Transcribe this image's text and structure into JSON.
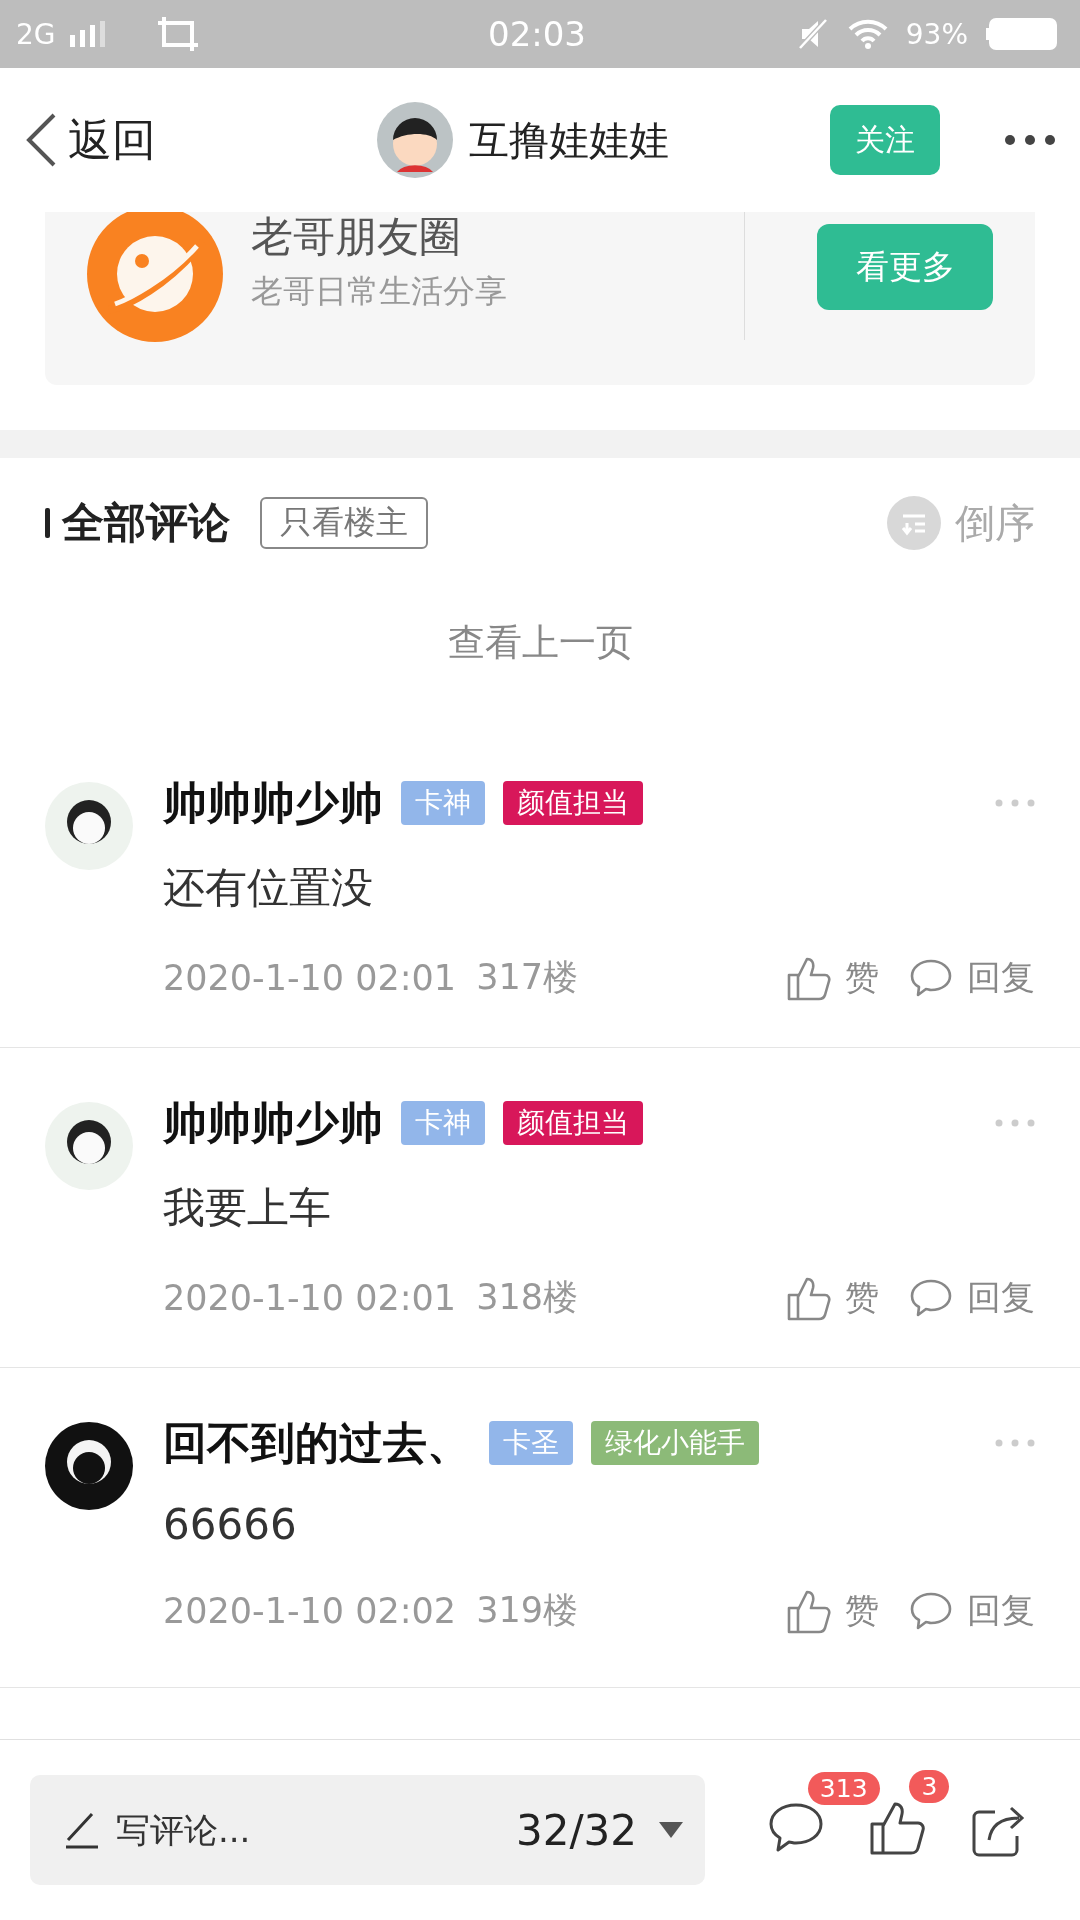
{
  "status_bar": {
    "network": "2G",
    "time": "02:03",
    "battery": "93%"
  },
  "header": {
    "back": "返回",
    "title": "互撸娃娃娃",
    "follow": "关注"
  },
  "group_card": {
    "name": "老哥朋友圈",
    "description": "老哥日常生活分享",
    "button": "看更多"
  },
  "comments_header": {
    "title": "全部评论",
    "filter": "只看楼主",
    "sort": "倒序"
  },
  "previous_page": "查看上一页",
  "comments": [
    {
      "name": "帅帅帅少帅",
      "tags": [
        {
          "text": "卡神",
          "color": "#92b6ea"
        },
        {
          "text": "颜值担当",
          "color": "#d8175a"
        }
      ],
      "body": "还有位置没",
      "time": "2020-1-10 02:01",
      "floor": "317楼",
      "like": "赞",
      "reply": "回复"
    },
    {
      "name": "帅帅帅少帅",
      "tags": [
        {
          "text": "卡神",
          "color": "#92b6ea"
        },
        {
          "text": "颜值担当",
          "color": "#d8175a"
        }
      ],
      "body": "我要上车",
      "time": "2020-1-10 02:01",
      "floor": "318楼",
      "like": "赞",
      "reply": "回复"
    },
    {
      "name": "回不到的过去、",
      "tags": [
        {
          "text": "卡圣",
          "color": "#92b6ea"
        },
        {
          "text": "绿化小能手",
          "color": "#8cba78"
        }
      ],
      "body": "66666",
      "time": "2020-1-10 02:02",
      "floor": "319楼",
      "like": "赞",
      "reply": "回复"
    }
  ],
  "bottom_bar": {
    "placeholder": "写评论...",
    "page": "32/32",
    "comment_count": "313",
    "like_count": "3"
  }
}
